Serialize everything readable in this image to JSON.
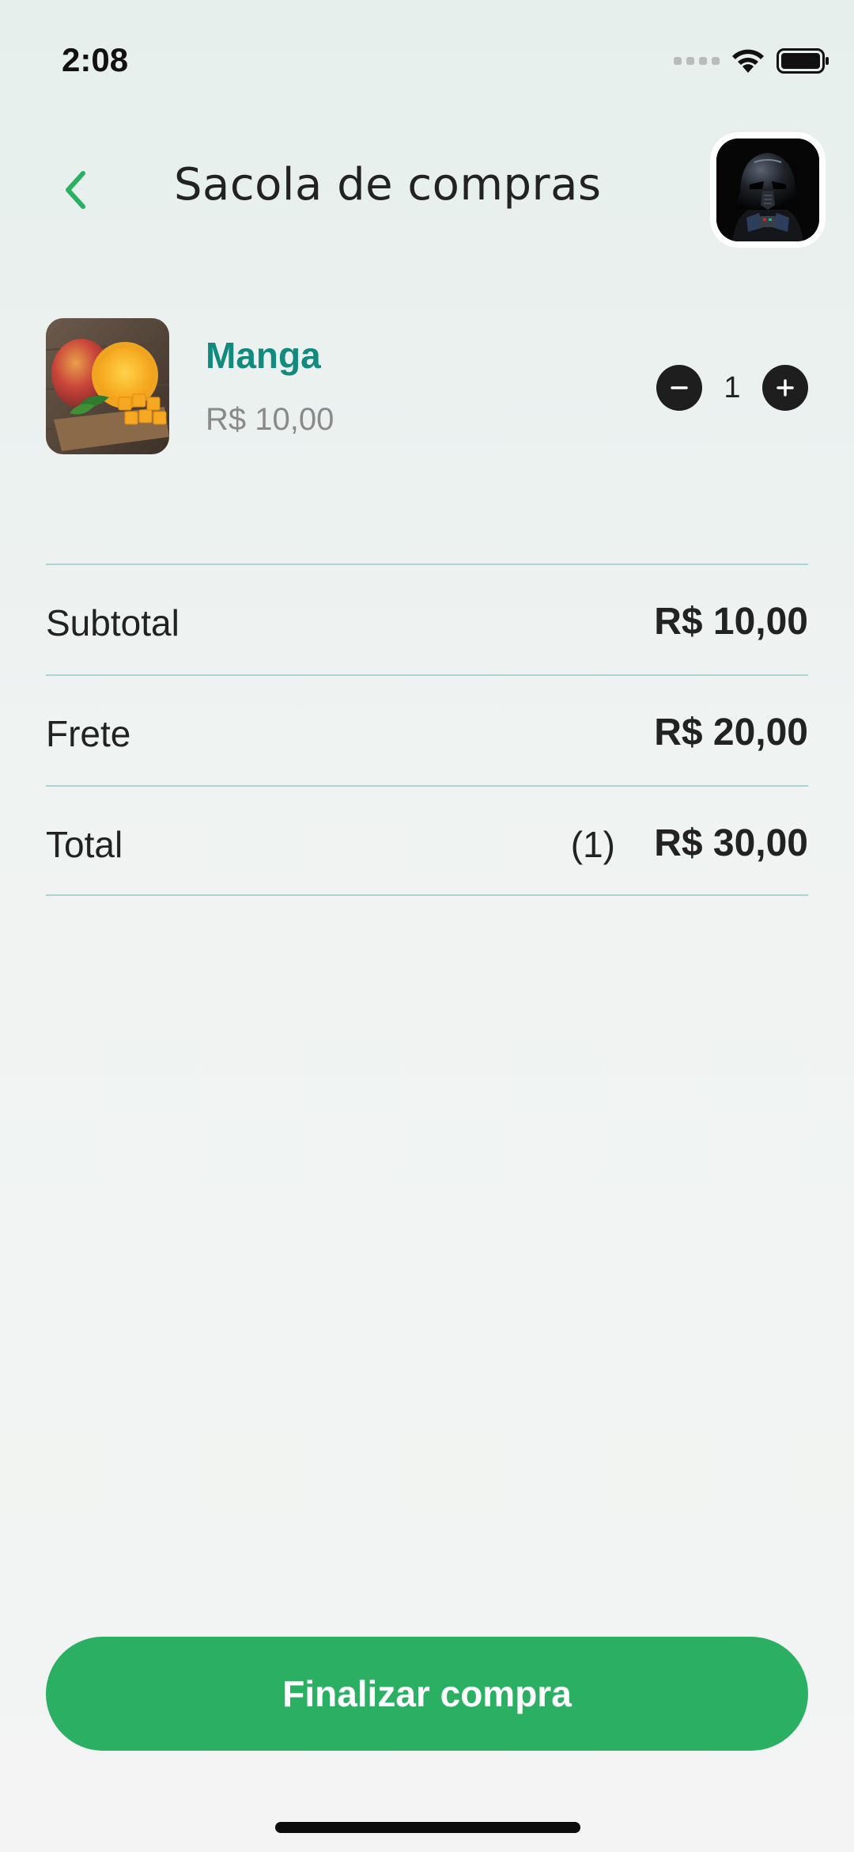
{
  "status_bar": {
    "time": "2:08",
    "icons": [
      "signal-icon",
      "wifi-icon",
      "battery-icon"
    ]
  },
  "header": {
    "title": "Sacola de compras",
    "back_icon": "chevron-left-icon",
    "avatar_icon": "darth-vader-avatar"
  },
  "cart": {
    "items": [
      {
        "name": "Manga",
        "price": "R$ 10,00",
        "quantity": "1",
        "image": "mango-photo"
      }
    ]
  },
  "summary": {
    "subtotal_label": "Subtotal",
    "subtotal_value": "R$ 10,00",
    "shipping_label": "Frete",
    "shipping_value": "R$ 20,00",
    "total_label": "Total",
    "total_count": "(1)",
    "total_value": "R$ 30,00"
  },
  "checkout": {
    "label": "Finalizar compra"
  },
  "colors": {
    "accent": "#2bb063",
    "product_name": "#138a7e",
    "divider": "#a9d6d2",
    "qty_button": "#1e1e1e"
  }
}
